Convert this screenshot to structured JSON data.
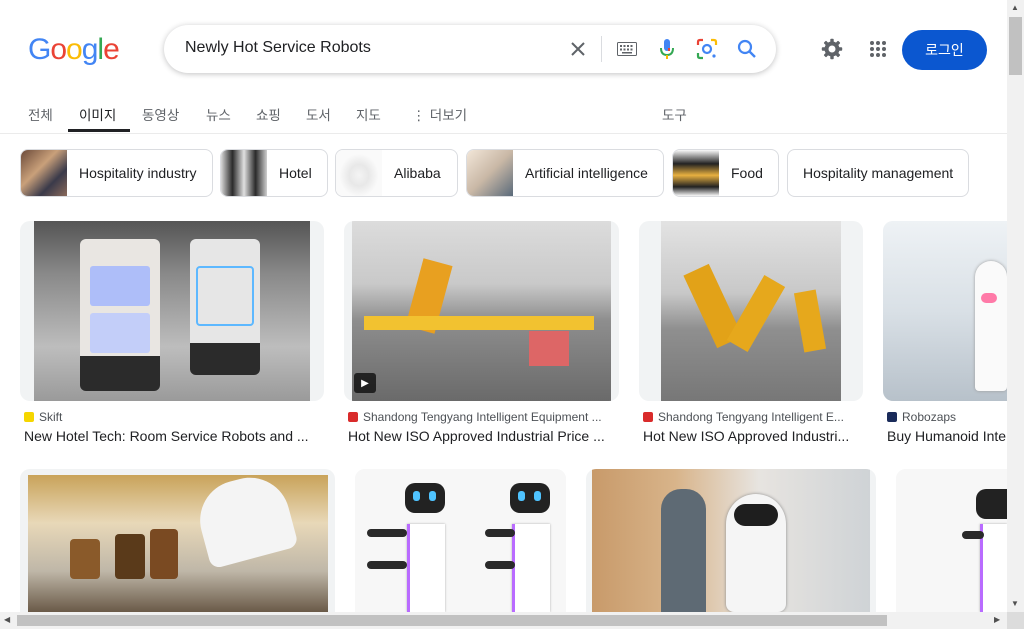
{
  "logo": {
    "letters": [
      "G",
      "o",
      "o",
      "g",
      "l",
      "e"
    ],
    "colors": [
      "#4285f4",
      "#ea4335",
      "#fbbc05",
      "#4285f4",
      "#34a853",
      "#ea4335"
    ]
  },
  "search": {
    "query": "Newly Hot Service Robots"
  },
  "header": {
    "login_label": "로그인"
  },
  "tabs": [
    {
      "label": "전체"
    },
    {
      "label": "이미지"
    },
    {
      "label": "동영상"
    },
    {
      "label": "뉴스"
    },
    {
      "label": "쇼핑"
    },
    {
      "label": "도서"
    },
    {
      "label": "지도"
    },
    {
      "label": "더보기"
    }
  ],
  "tools_label": "도구",
  "chips": [
    {
      "label": "Hospitality industry"
    },
    {
      "label": "Hotel"
    },
    {
      "label": "Alibaba"
    },
    {
      "label": "Artificial intelligence"
    },
    {
      "label": "Food"
    },
    {
      "label": "Hospitality management"
    }
  ],
  "results": [
    {
      "source": "Skift",
      "title": "New Hotel Tech: Room Service Robots and ..."
    },
    {
      "source": "Shandong Tengyang Intelligent Equipment ...",
      "title": "Hot New ISO Approved Industrial Price ..."
    },
    {
      "source": "Shandong Tengyang Intelligent E...",
      "title": "Hot New ISO Approved Industri..."
    },
    {
      "source": "Robozaps",
      "title": "Buy Humanoid Inte"
    }
  ],
  "colors": {
    "accent": "#0b57d0",
    "mic_blue": "#4285f4"
  }
}
